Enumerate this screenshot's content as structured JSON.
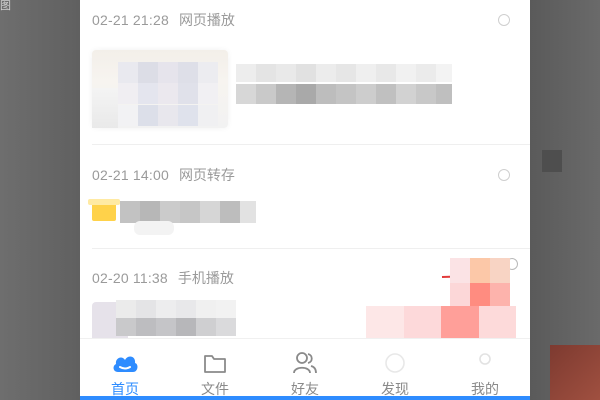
{
  "corner": {
    "glyph": "图"
  },
  "list": {
    "items": [
      {
        "time": "02-21 21:28",
        "type": "网页播放"
      },
      {
        "time": "02-21 14:00",
        "type": "网页转存"
      },
      {
        "time": "02-20 11:38",
        "type": "手机播放"
      }
    ]
  },
  "tabbar": {
    "tabs": [
      {
        "label": "首页",
        "icon": "cloud-icon",
        "active": true
      },
      {
        "label": "文件",
        "icon": "folder-icon",
        "active": false
      },
      {
        "label": "好友",
        "icon": "friends-icon",
        "active": false
      },
      {
        "label": "发现",
        "icon": "discover-icon",
        "active": false
      },
      {
        "label": "我的",
        "icon": "profile-icon",
        "active": false
      }
    ]
  },
  "colors": {
    "accent": "#2e8cff",
    "annotation_red": "#e23b3b",
    "text_muted": "#9a9a9a"
  }
}
